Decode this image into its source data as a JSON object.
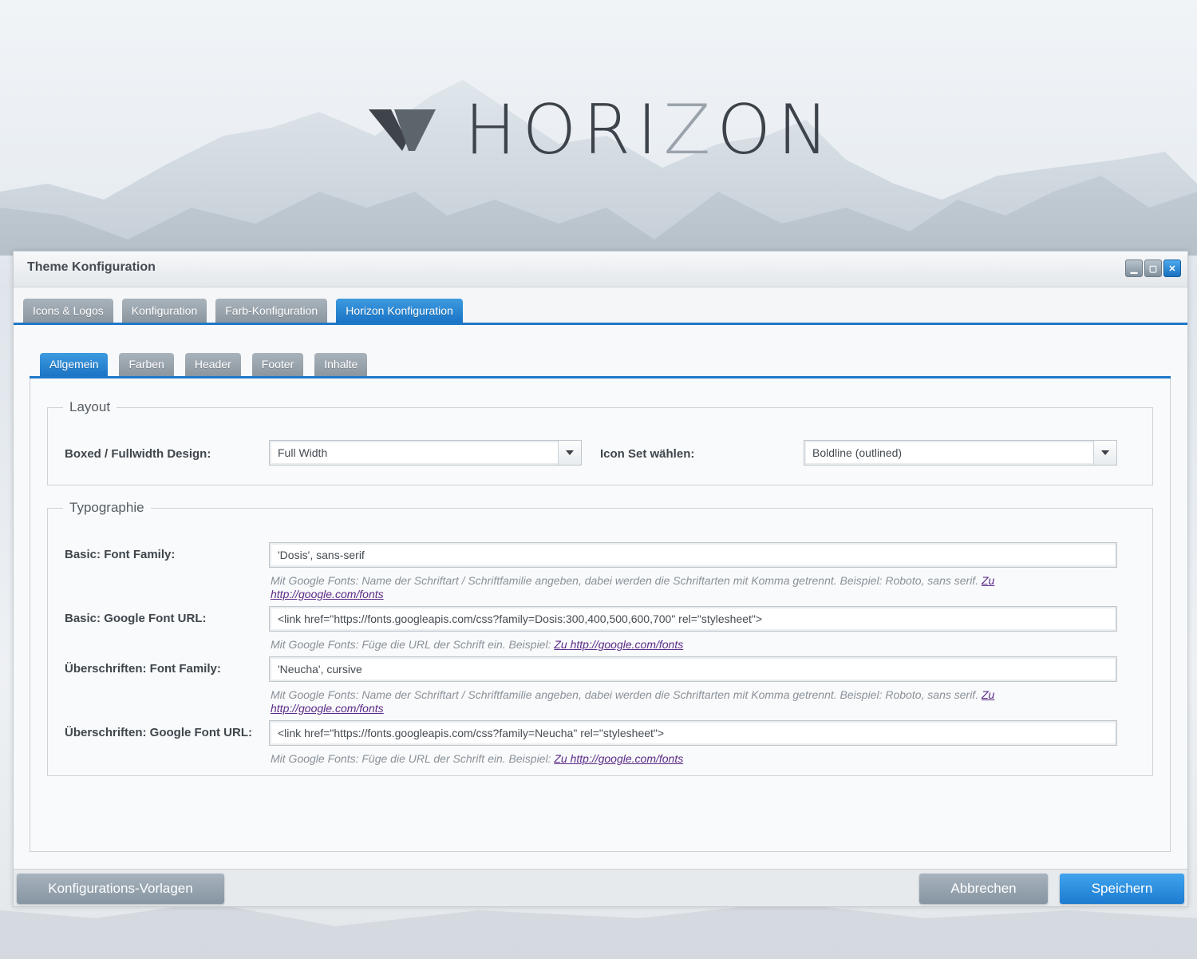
{
  "brand": {
    "name_prefix": "HORI",
    "name_z": "Z",
    "name_suffix": "ON"
  },
  "window": {
    "title": "Theme Konfiguration",
    "controls": [
      "minimize",
      "maximize",
      "close"
    ]
  },
  "main_tabs": [
    {
      "label": "Icons & Logos",
      "active": false
    },
    {
      "label": "Konfiguration",
      "active": false
    },
    {
      "label": "Farb-Konfiguration",
      "active": false
    },
    {
      "label": "Horizon Konfiguration",
      "active": true
    }
  ],
  "sub_tabs": [
    {
      "label": "Allgemein",
      "active": true
    },
    {
      "label": "Farben",
      "active": false
    },
    {
      "label": "Header",
      "active": false
    },
    {
      "label": "Footer",
      "active": false
    },
    {
      "label": "Inhalte",
      "active": false
    }
  ],
  "layout": {
    "legend": "Layout",
    "boxed_label": "Boxed / Fullwidth Design:",
    "boxed_value": "Full Width",
    "iconset_label": "Icon Set wählen:",
    "iconset_value": "Boldline (outlined)"
  },
  "typography": {
    "legend": "Typographie",
    "basic_font_family_label": "Basic: Font Family:",
    "basic_font_family_value": "'Dosis', sans-serif",
    "basic_font_family_help": "Mit Google Fonts: Name der Schriftart / Schriftfamilie angeben, dabei werden die Schriftarten mit Komma getrennt. Beispiel: Roboto, sans serif.",
    "basic_font_family_link_a": "Zu",
    "basic_font_family_link_b": "http://google.com/fonts",
    "basic_font_url_label": "Basic: Google Font URL:",
    "basic_font_url_value": "<link href=\"https://fonts.googleapis.com/css?family=Dosis:300,400,500,600,700\" rel=\"stylesheet\">",
    "basic_font_url_help": "Mit Google Fonts: Füge die URL der Schrift ein. Beispiel:",
    "basic_font_url_link": "Zu http://google.com/fonts",
    "heading_font_family_label": "Überschriften: Font Family:",
    "heading_font_family_value": "'Neucha', cursive",
    "heading_font_family_help": "Mit Google Fonts: Name der Schriftart / Schriftfamilie angeben, dabei werden die Schriftarten mit Komma getrennt. Beispiel: Roboto, sans serif.",
    "heading_font_family_link_a": "Zu",
    "heading_font_family_link_b": "http://google.com/fonts",
    "heading_font_url_label": "Überschriften: Google Font URL:",
    "heading_font_url_value": "<link href=\"https://fonts.googleapis.com/css?family=Neucha\" rel=\"stylesheet\">",
    "heading_font_url_help": "Mit Google Fonts: Füge die URL der Schrift ein. Beispiel:",
    "heading_font_url_link": "Zu http://google.com/fonts"
  },
  "footer": {
    "templates_label": "Konfigurations-Vorlagen",
    "cancel_label": "Abbrechen",
    "save_label": "Speichern"
  },
  "colors": {
    "accent": "#1f78c7",
    "tab_inactive": "#98a3ac",
    "link": "#5b2a86"
  }
}
